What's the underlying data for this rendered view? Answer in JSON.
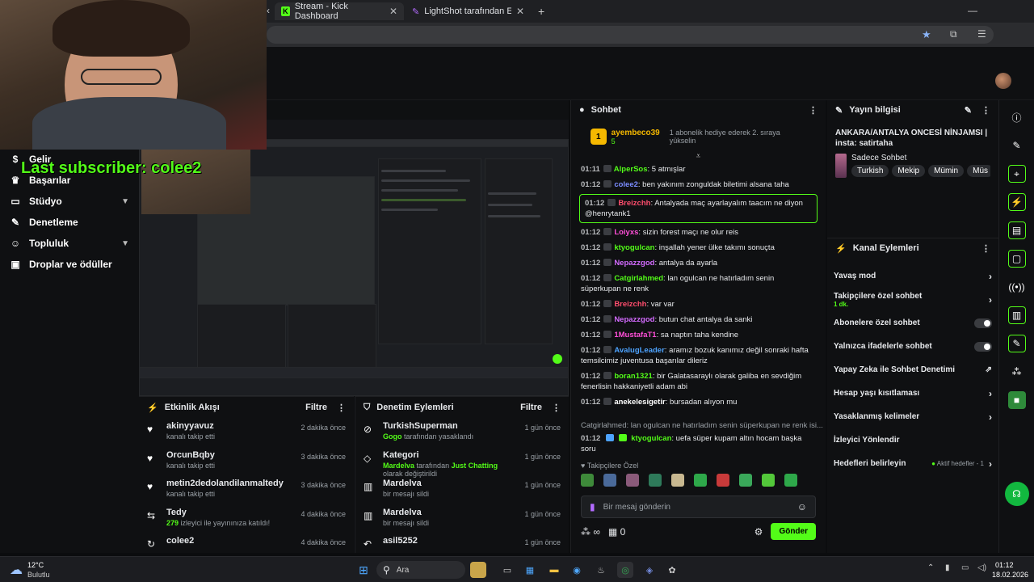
{
  "browser": {
    "tabs": [
      {
        "label": "Stream - Kick Dashboard"
      },
      {
        "label": "LightShot tarafından Ekran Gör"
      }
    ]
  },
  "overlay": {
    "last_subscriber": "Last subscriber: colee2"
  },
  "sidebar": {
    "items": [
      {
        "label": "Gelir",
        "icon": "dollar-icon"
      },
      {
        "label": "Başarılar",
        "icon": "trophy-icon"
      },
      {
        "label": "Stüdyo",
        "icon": "studio-icon",
        "expandable": true
      },
      {
        "label": "Denetleme",
        "icon": "wrench-icon"
      },
      {
        "label": "Topluluk",
        "icon": "community-icon",
        "expandable": true
      },
      {
        "label": "Droplar ve ödüller",
        "icon": "gift-icon"
      }
    ]
  },
  "activity_feed": {
    "title": "Etkinlik Akışı",
    "filter_label": "Filtre",
    "items": [
      {
        "name": "akinyyavuz",
        "desc": "kanalı takip etti",
        "time": "2 dakika önce",
        "icon": "heart-icon"
      },
      {
        "name": "OrcunBqby",
        "desc": "kanalı takip etti",
        "time": "3 dakika önce",
        "icon": "heart-icon"
      },
      {
        "name": "metin2dedolandilanmaltedy",
        "desc": "kanalı takip etti",
        "time": "3 dakika önce",
        "icon": "heart-icon"
      },
      {
        "name": "Tedy",
        "desc_highlight": "279",
        "desc": "izleyici ile yayınınıza katıldı!",
        "time": "4 dakika önce",
        "icon": "raid-icon"
      },
      {
        "name": "colee2",
        "desc": "",
        "time": "4 dakika önce",
        "icon": "sub-icon"
      }
    ]
  },
  "mod_actions": {
    "title": "Denetim Eylemleri",
    "filter_label": "Filtre",
    "items": [
      {
        "name": "TurkishSuperman",
        "actor": "Gogo",
        "desc": "tarafından yasaklandı",
        "time": "1 gün önce",
        "icon": "ban-icon"
      },
      {
        "name": "Kategori",
        "actor": "Mardelva",
        "desc": "tarafından",
        "highlight": "Just Chatting",
        "desc2": "olarak değiştirildi",
        "time": "1 gün önce",
        "icon": "category-icon"
      },
      {
        "name": "Mardelva",
        "desc": "bir mesajı sildi",
        "time": "1 gün önce",
        "icon": "trash-icon"
      },
      {
        "name": "Mardelva",
        "desc": "bir mesajı sildi",
        "time": "1 gün önce",
        "icon": "trash-icon"
      },
      {
        "name": "asil5252",
        "desc": "",
        "time": "1 gün önce",
        "icon": "undo-icon"
      }
    ]
  },
  "chat": {
    "title": "Sohbet",
    "pinned": {
      "user": "ayembeco39",
      "count": "5",
      "text": "1 abonelik hediye ederek 2. sıraya yükselin"
    },
    "messages": [
      {
        "time": "01:11",
        "user": "AlperSos",
        "color": "#53fc18",
        "text": "5 atmışlar"
      },
      {
        "time": "01:12",
        "user": "colee2",
        "color": "#7b8cff",
        "text": "ben yakınım zonguldak biletimi alsana taha"
      },
      {
        "time": "01:12",
        "user": "Breizchh",
        "color": "#ff4d6d",
        "text": "Antalyada maç ayarlayalım taacım ne diyon @henrytank1",
        "highlight": true
      },
      {
        "time": "01:12",
        "user": "Loiyxs",
        "color": "#ff4fd8",
        "text": "sizin forest maçı ne olur reis"
      },
      {
        "time": "01:12",
        "user": "ktyogulcan",
        "color": "#53fc18",
        "text": "inşallah yener ülke takımı sonuçta"
      },
      {
        "time": "01:12",
        "user": "Nepazzgod",
        "color": "#d36bff",
        "text": "antalya da ayarla"
      },
      {
        "time": "01:12",
        "user": "Catgirlahmed",
        "color": "#53fc18",
        "text": "lan ogulcan ne hatırladım senin süperkupan ne renk"
      },
      {
        "time": "01:12",
        "user": "Breizchh",
        "color": "#ff4d6d",
        "text": "var var"
      },
      {
        "time": "01:12",
        "user": "Nepazzgod",
        "color": "#d36bff",
        "text": "butun chat antalya da sanki"
      },
      {
        "time": "01:12",
        "user": "1MustafaT1",
        "color": "#ff4fd8",
        "text": "sa naptın taha kendine"
      },
      {
        "time": "01:12",
        "user": "AvalugLeader",
        "color": "#4da3ff",
        "text": "aramız bozuk kanımız değil sonraki hafta temsilcimiz juventusa başarılar dileriz"
      },
      {
        "time": "01:12",
        "user": "boran1321",
        "color": "#53fc18",
        "text": "bir Galatasaraylı olarak galiba en sevdiğim fenerlisin hakkaniyetli adam abi"
      },
      {
        "time": "01:12",
        "user": "anekelesigetir",
        "color": "#ffffff",
        "text": "bursadan alıyon mu"
      }
    ],
    "reply_preview": "Catgirlahmed: lan ogulcan ne hatırladım senin süperkupan ne renk isi...",
    "reply_message": {
      "time": "01:12",
      "user": "ktyogulcan",
      "color": "#53fc18",
      "text": "uefa süper kupam altın hocam başka soru"
    },
    "emote_section": "Takipçilere Özel",
    "input_placeholder": "Bir mesaj gönderin",
    "points": "∞",
    "gift_count": "0",
    "send_label": "Gönder"
  },
  "stream_info": {
    "title": "Yayın bilgisi",
    "stream_title": "ANKARA/ANTALYA ONCESİ NİNJAMSI | insta: satirtaha",
    "category": "Sadece Sohbet",
    "tags": [
      "Turkish",
      "Mekip",
      "Mümin",
      "Müs"
    ]
  },
  "channel_actions": {
    "title": "Kanal Eylemleri",
    "items": [
      {
        "label": "Yavaş mod",
        "control": "chevron"
      },
      {
        "label": "Takipçilere özel sohbet",
        "sub": "1 dk.",
        "control": "chevron"
      },
      {
        "label": "Abonelere özel sohbet",
        "control": "toggle"
      },
      {
        "label": "Yalnızca ifadelerle sohbet",
        "control": "toggle"
      },
      {
        "label": "Yapay Zeka ile Sohbet Denetimi",
        "control": "external"
      },
      {
        "label": "Hesap yaşı kısıtlaması",
        "control": "chevron"
      },
      {
        "label": "Yasaklanmış kelimeler",
        "control": "chevron"
      },
      {
        "label": "İzleyici Yönlendir",
        "control": "none"
      },
      {
        "label": "Hedefleri belirleyin",
        "status": "Aktif hedefler - 1",
        "control": "chevron"
      }
    ]
  },
  "taskbar": {
    "weather_temp": "12°C",
    "weather_desc": "Bulutlu",
    "search_label": "Ara",
    "time": "01:12",
    "date": "18.02.2026"
  },
  "colors": {
    "accent": "#53fc18",
    "bg": "#0f1012"
  }
}
